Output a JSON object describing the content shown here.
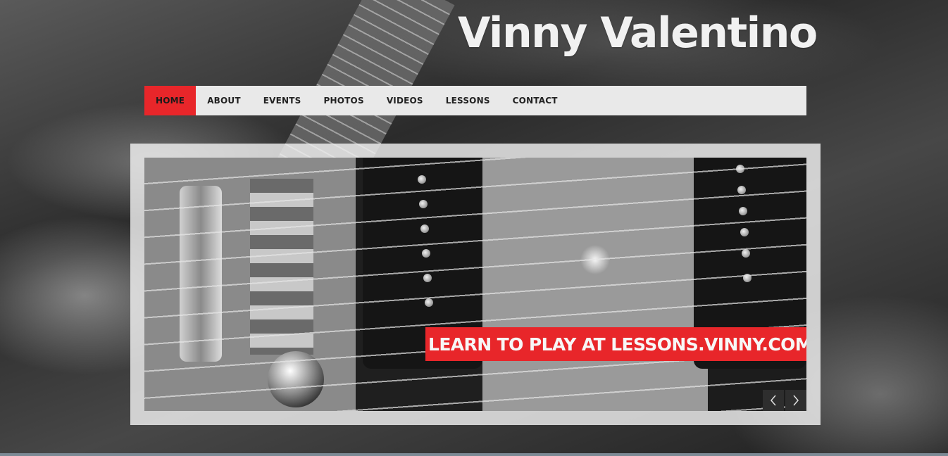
{
  "site": {
    "title": "Vinny Valentino"
  },
  "nav": {
    "items": [
      {
        "label": "HOME",
        "active": true
      },
      {
        "label": "ABOUT",
        "active": false
      },
      {
        "label": "EVENTS",
        "active": false
      },
      {
        "label": "PHOTOS",
        "active": false
      },
      {
        "label": "VIDEOS",
        "active": false
      },
      {
        "label": "LESSONS",
        "active": false
      },
      {
        "label": "CONTACT",
        "active": false
      }
    ]
  },
  "slider": {
    "caption": "LEARN TO PLAY AT LESSONS.VINNY.COM",
    "prev_icon": "chevron-left-icon",
    "next_icon": "chevron-right-icon"
  },
  "colors": {
    "accent": "#e8262a",
    "nav_background": "#e9e9e9",
    "title_text": "#f1f1f1"
  }
}
